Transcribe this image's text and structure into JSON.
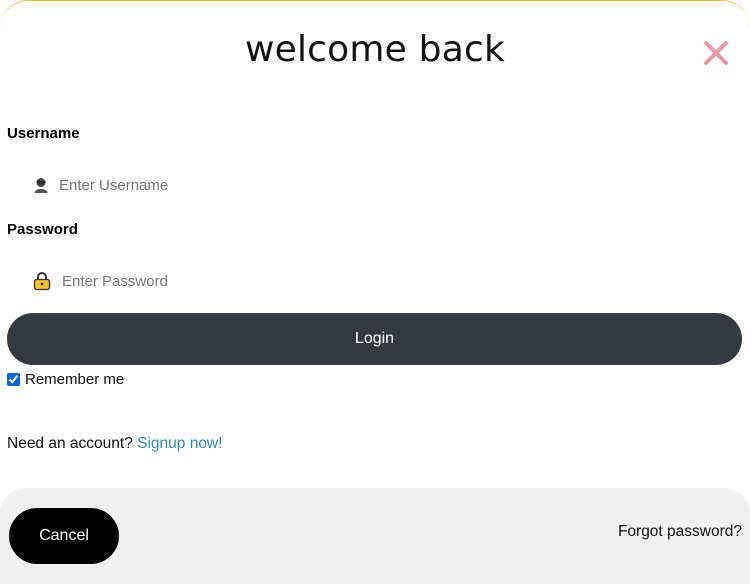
{
  "modal": {
    "title": "welcome back",
    "close_color": "#ea9aa4"
  },
  "form": {
    "username": {
      "label": "Username",
      "placeholder": "Enter Username",
      "icon": "user-icon"
    },
    "password": {
      "label": "Password",
      "placeholder": "Enter Password",
      "icon": "lock-icon"
    },
    "login_label": "Login",
    "remember_label": "Remember me",
    "remember_checked": true,
    "signup_prompt": "Need an account?",
    "signup_link": "Signup now!"
  },
  "footer": {
    "cancel_label": "Cancel",
    "forgot_label": "Forgot password?"
  },
  "colors": {
    "login_button": "#343a40",
    "cancel_button": "#000000",
    "link": "#2f8bb0",
    "footer_bg": "#f0f0f0"
  }
}
